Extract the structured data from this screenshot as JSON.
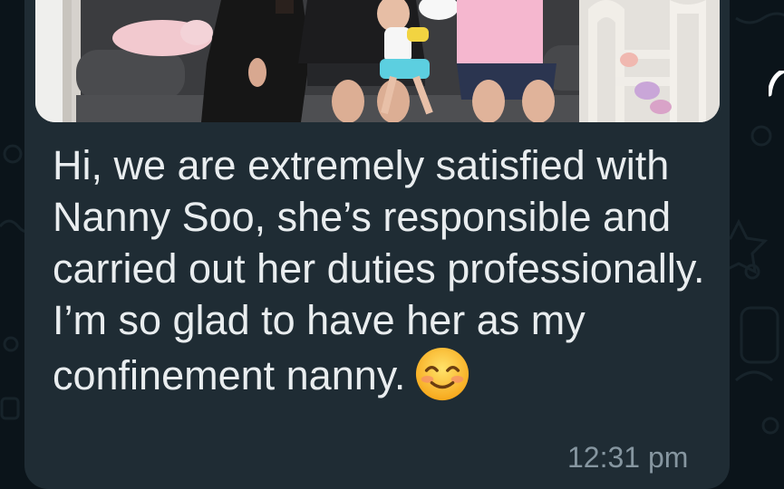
{
  "message": {
    "text": "Hi, we are extremely satisfied with Nanny Soo, she’s responsible and carried out her duties professionally. I’m so glad to have her as my confinement nanny.",
    "emoji": "smiling-face-with-smiling-eyes",
    "timestamp": "12:31 pm"
  },
  "colors": {
    "background": "#0b141a",
    "bubble": "#1f2c34",
    "text": "#e9edef",
    "timestamp": "#8696a0"
  }
}
